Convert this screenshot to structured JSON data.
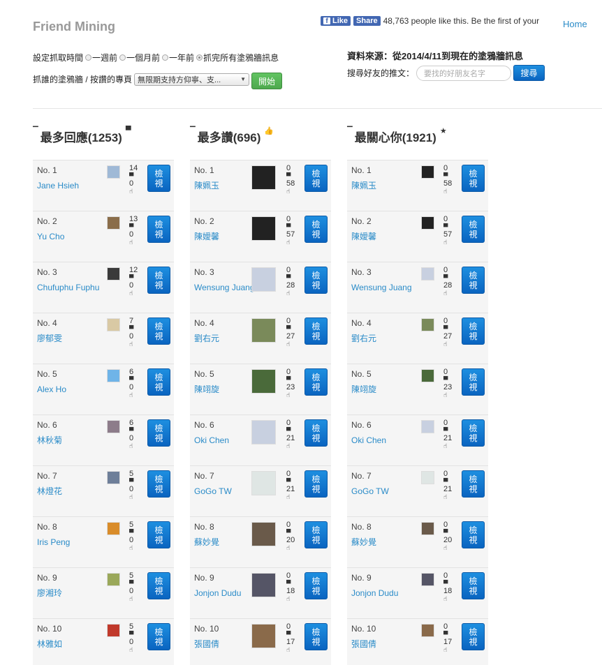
{
  "brand": "Friend Mining",
  "facebook": {
    "like": "Like",
    "share": "Share",
    "text": "48,763 people like this. Be the first of your"
  },
  "nav": {
    "home": "Home",
    "extra": ""
  },
  "controls": {
    "time_label": "設定抓取時間",
    "options": [
      "一週前",
      "一個月前",
      "一年前",
      "抓完所有塗鴉牆訊息"
    ],
    "target_label": "抓誰的塗鴉牆 / 按讚的專頁",
    "target_value": "無限期支持方仰寧、支...",
    "start_button": "開始"
  },
  "source_text": "資料來源：從2014/4/11到現在的塗鴉牆訊息",
  "search": {
    "label": "搜尋好友的推文：",
    "placeholder": "要找的好朋友名字",
    "button": "搜尋"
  },
  "icons": {
    "comment": "comment-icon",
    "like": "thumbs-up-icon",
    "star": "star-icon"
  },
  "view_label": "檢視",
  "columns": [
    {
      "title": "最多回應(1253)",
      "icon": "comment-icon",
      "items": [
        {
          "no": "No. 1",
          "name": "Jane Hsieh",
          "comments": "14",
          "likes": "0",
          "avatar": "#9fb9d6"
        },
        {
          "no": "No. 2",
          "name": "Yu Cho",
          "comments": "13",
          "likes": "0",
          "avatar": "#8a6d4a"
        },
        {
          "no": "No. 3",
          "name": "Chufuphu Fuphu",
          "comments": "12",
          "likes": "0",
          "avatar": "#3a3a3a"
        },
        {
          "no": "No. 4",
          "name": "廖郁雯",
          "comments": "7",
          "likes": "0",
          "avatar": "#d9c9a4"
        },
        {
          "no": "No. 5",
          "name": "Alex Ho",
          "comments": "6",
          "likes": "0",
          "avatar": "#6fb4e8"
        },
        {
          "no": "No. 6",
          "name": "林秋菊",
          "comments": "6",
          "likes": "0",
          "avatar": "#8d7c8a"
        },
        {
          "no": "No. 7",
          "name": "林燈花",
          "comments": "5",
          "likes": "0",
          "avatar": "#6e7f99"
        },
        {
          "no": "No. 8",
          "name": "Iris Peng",
          "comments": "5",
          "likes": "0",
          "avatar": "#d98c2a"
        },
        {
          "no": "No. 9",
          "name": "廖湘玲",
          "comments": "5",
          "likes": "0",
          "avatar": "#9aa85a"
        },
        {
          "no": "No. 10",
          "name": "林雅如",
          "comments": "5",
          "likes": "0",
          "avatar": "#c0392b"
        }
      ]
    },
    {
      "title": "最多讚(696)",
      "icon": "thumbs-up-icon",
      "items": [
        {
          "no": "No. 1",
          "name": "陳姵玉",
          "comments": "0",
          "likes": "58",
          "avatar": "#222222"
        },
        {
          "no": "No. 2",
          "name": "陳嬡馨",
          "comments": "0",
          "likes": "57",
          "avatar": "#222222"
        },
        {
          "no": "No. 3",
          "name": "Wensung Juang",
          "comments": "0",
          "likes": "28",
          "avatar": "#c8d0e0"
        },
        {
          "no": "No. 4",
          "name": "劉右元",
          "comments": "0",
          "likes": "27",
          "avatar": "#7a8a5a"
        },
        {
          "no": "No. 5",
          "name": "陳翊旋",
          "comments": "0",
          "likes": "23",
          "avatar": "#4a6a3a"
        },
        {
          "no": "No. 6",
          "name": "Oki Chen",
          "comments": "0",
          "likes": "21",
          "avatar": "#c8d0e0"
        },
        {
          "no": "No. 7",
          "name": "GoGo TW",
          "comments": "0",
          "likes": "21",
          "avatar": "#dfe6e4"
        },
        {
          "no": "No. 8",
          "name": "蘇妙覺",
          "comments": "0",
          "likes": "20",
          "avatar": "#6a5a4a"
        },
        {
          "no": "No. 9",
          "name": "Jonjon Dudu",
          "comments": "0",
          "likes": "18",
          "avatar": "#555566"
        },
        {
          "no": "No. 10",
          "name": "張國倩",
          "comments": "0",
          "likes": "17",
          "avatar": "#8a6a4a"
        }
      ]
    },
    {
      "title": "最關心你(1921)",
      "icon": "star-icon",
      "items": [
        {
          "no": "No. 1",
          "name": "陳姵玉",
          "comments": "0",
          "likes": "58",
          "avatar": "#222222"
        },
        {
          "no": "No. 2",
          "name": "陳嬡馨",
          "comments": "0",
          "likes": "57",
          "avatar": "#222222"
        },
        {
          "no": "No. 3",
          "name": "Wensung Juang",
          "comments": "0",
          "likes": "28",
          "avatar": "#c8d0e0"
        },
        {
          "no": "No. 4",
          "name": "劉右元",
          "comments": "0",
          "likes": "27",
          "avatar": "#7a8a5a"
        },
        {
          "no": "No. 5",
          "name": "陳翊旋",
          "comments": "0",
          "likes": "23",
          "avatar": "#4a6a3a"
        },
        {
          "no": "No. 6",
          "name": "Oki Chen",
          "comments": "0",
          "likes": "21",
          "avatar": "#c8d0e0"
        },
        {
          "no": "No. 7",
          "name": "GoGo TW",
          "comments": "0",
          "likes": "21",
          "avatar": "#dfe6e4"
        },
        {
          "no": "No. 8",
          "name": "蘇妙覺",
          "comments": "0",
          "likes": "20",
          "avatar": "#6a5a4a"
        },
        {
          "no": "No. 9",
          "name": "Jonjon Dudu",
          "comments": "0",
          "likes": "18",
          "avatar": "#555566"
        },
        {
          "no": "No. 10",
          "name": "張國倩",
          "comments": "0",
          "likes": "17",
          "avatar": "#8a6a4a"
        }
      ]
    }
  ]
}
